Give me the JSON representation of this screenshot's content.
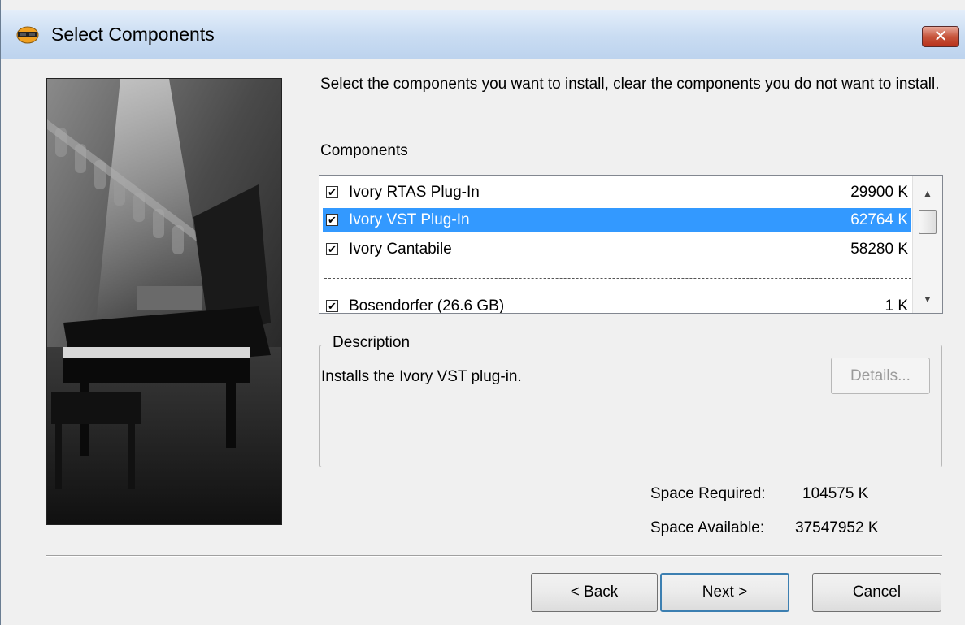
{
  "window": {
    "title": "Select Components",
    "app_icon": "installer-icon",
    "close_glyph": "✕"
  },
  "instructions": "Select the components you want to install, clear the components you do not want to install.",
  "components_label": "Components",
  "components": [
    {
      "name": "Ivory RTAS Plug-In",
      "size": "29900 K",
      "checked": true,
      "selected": false
    },
    {
      "name": "Ivory VST Plug-In",
      "size": "62764 K",
      "checked": true,
      "selected": true
    },
    {
      "name": "Ivory Cantabile",
      "size": "58280 K",
      "checked": true,
      "selected": false
    },
    {
      "name": "Bosendorfer (26.6 GB)",
      "size": "1 K",
      "checked": true,
      "selected": false
    }
  ],
  "description": {
    "legend": "Description",
    "text": "Installs the Ivory VST plug-in.",
    "details_label": "Details..."
  },
  "space": {
    "required_label": "Space Required:",
    "required_value": "104575 K",
    "available_label": "Space Available:",
    "available_value": "37547952 K"
  },
  "buttons": {
    "back": "< Back",
    "next": "Next >",
    "cancel": "Cancel"
  },
  "colors": {
    "selection": "#3399ff",
    "titlebar": "#c9dcf2"
  }
}
